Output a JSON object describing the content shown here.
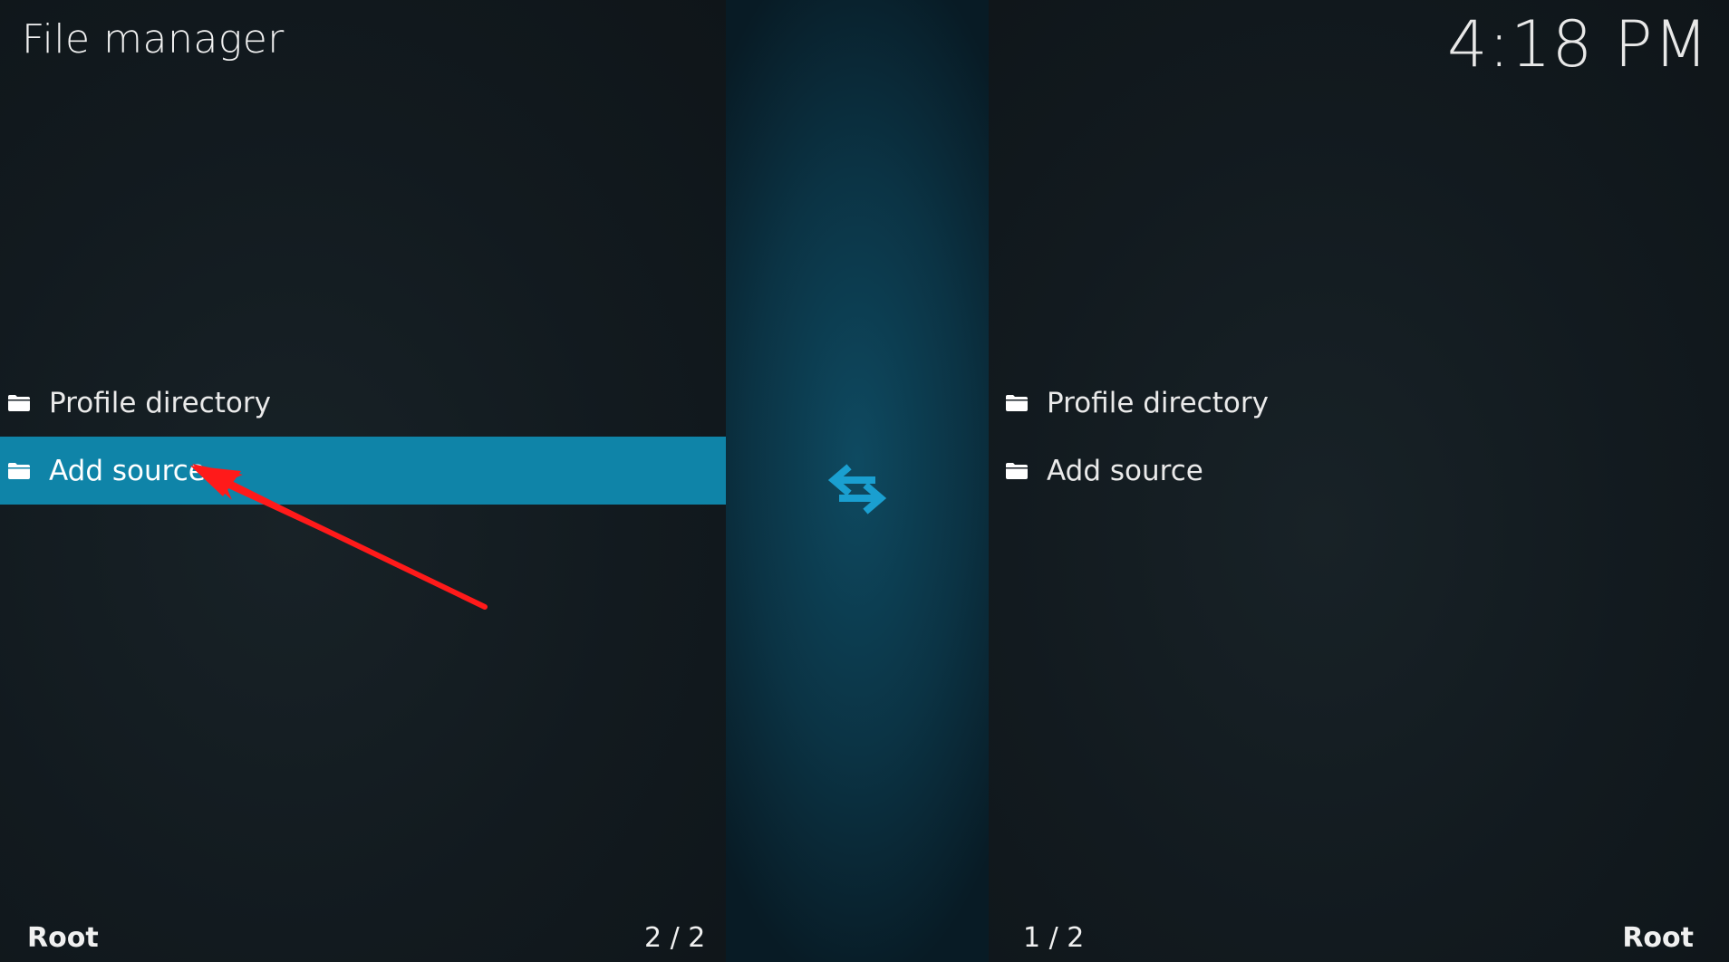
{
  "header": {
    "title": "File manager",
    "clock": "4:18 PM"
  },
  "left_pane": {
    "items": [
      {
        "label": "Profile directory",
        "icon": "folder-icon"
      },
      {
        "label": "Add source",
        "icon": "folder-icon",
        "focused": true
      }
    ],
    "footer": {
      "path": "Root",
      "count": "2 / 2"
    }
  },
  "right_pane": {
    "items": [
      {
        "label": "Profile directory",
        "icon": "folder-icon"
      },
      {
        "label": "Add source",
        "icon": "folder-icon"
      }
    ],
    "footer": {
      "path": "Root",
      "count": "1 / 2"
    }
  },
  "center": {
    "icon": "swap-arrows-icon"
  },
  "colors": {
    "background": "#121a1f",
    "focus_highlight": "#0f84a8",
    "swap_icon": "#1a9fd0",
    "annotation": "#ff1a1a"
  }
}
